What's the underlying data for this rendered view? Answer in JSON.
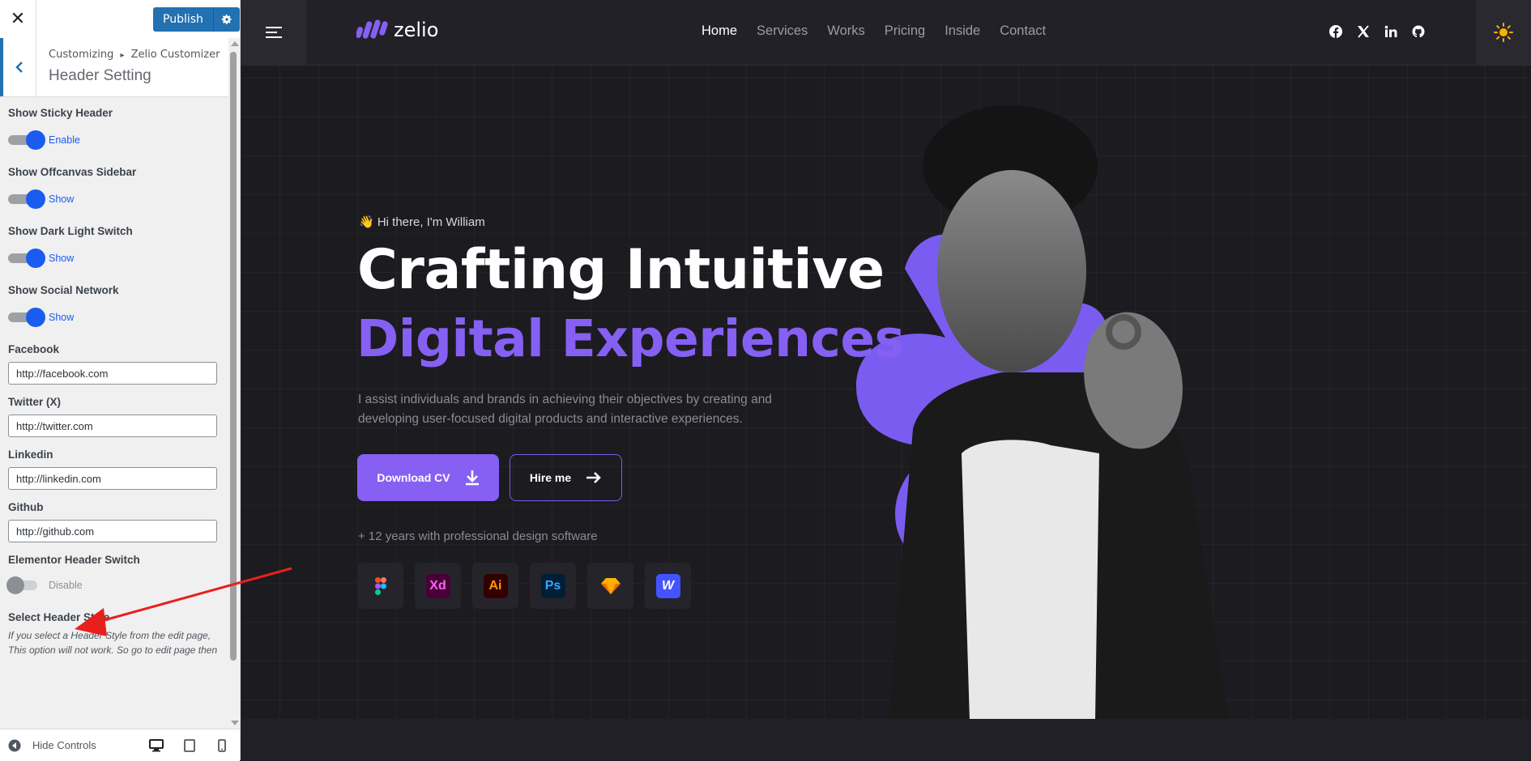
{
  "customizer": {
    "close_icon": "close-icon",
    "publish_label": "Publish",
    "breadcrumb_root": "Customizing",
    "breadcrumb_sep": "▸",
    "breadcrumb_parent": "Zelio Customizer",
    "section_title": "Header Setting",
    "controls": {
      "sticky": {
        "label": "Show Sticky Header",
        "state": "Enable"
      },
      "offcanvas": {
        "label": "Show Offcanvas Sidebar",
        "state": "Show"
      },
      "darklight": {
        "label": "Show Dark Light Switch",
        "state": "Show"
      },
      "social": {
        "label": "Show Social Network",
        "state": "Show"
      },
      "facebook": {
        "label": "Facebook",
        "value": "http://facebook.com"
      },
      "twitter": {
        "label": "Twitter (X)",
        "value": "http://twitter.com"
      },
      "linkedin": {
        "label": "Linkedin",
        "value": "http://linkedin.com"
      },
      "github": {
        "label": "Github",
        "value": "http://github.com"
      },
      "elementor": {
        "label": "Elementor Header Switch",
        "state": "Disable"
      },
      "header_style": {
        "label": "Select Header Style",
        "description": "If you select a Header Style from the edit page, This option will not work. So go to edit page then change the header style."
      }
    },
    "footer": {
      "hide_controls": "Hide Controls"
    }
  },
  "site": {
    "logo_text": "zelio",
    "nav": [
      "Home",
      "Services",
      "Works",
      "Pricing",
      "Inside",
      "Contact"
    ],
    "active_nav": "Home",
    "socials": [
      "facebook-icon",
      "x-icon",
      "linkedin-icon",
      "github-icon"
    ],
    "hero": {
      "greeting": "👋 Hi there, I'm William",
      "title_line1": "Crafting Intuitive",
      "title_line2": "Digital Experiences",
      "lead": "I assist individuals and brands in achieving their objectives by creating and developing user-focused digital products and interactive experiences.",
      "cta_primary": "Download CV",
      "cta_secondary": "Hire me",
      "experience": "+ 12 years with professional design software",
      "tools": [
        {
          "name": "figma",
          "text": ""
        },
        {
          "name": "adobe-xd",
          "text": "Xd"
        },
        {
          "name": "illustrator",
          "text": "Ai"
        },
        {
          "name": "photoshop",
          "text": "Ps"
        },
        {
          "name": "sketch",
          "text": ""
        },
        {
          "name": "webflow",
          "text": "W"
        }
      ]
    }
  },
  "colors": {
    "accent": "#8560f3",
    "wp_blue": "#2271b1",
    "toggle_on": "#1a5cf0",
    "annotation_arrow": "#e8201c"
  }
}
